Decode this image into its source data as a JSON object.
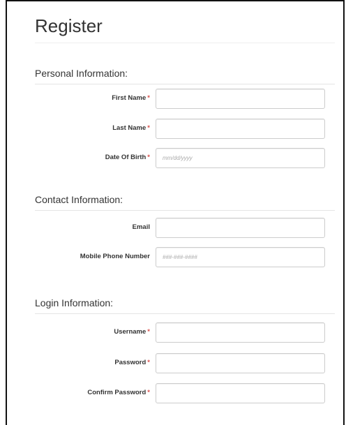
{
  "form": {
    "title": "Register",
    "sections": [
      {
        "heading": "Personal Information:",
        "fields": [
          {
            "label": "First Name",
            "required_mark": "*",
            "value": "",
            "placeholder": ""
          },
          {
            "label": "Last Name",
            "required_mark": "*",
            "value": "",
            "placeholder": ""
          },
          {
            "label": "Date Of Birth",
            "required_mark": "*",
            "value": "",
            "placeholder": "mm/dd/yyyy"
          }
        ]
      },
      {
        "heading": "Contact Information:",
        "fields": [
          {
            "label": "Email",
            "required_mark": "",
            "value": "",
            "placeholder": ""
          },
          {
            "label": "Mobile Phone Number",
            "required_mark": "",
            "value": "",
            "placeholder": "###-###-####"
          }
        ]
      },
      {
        "heading": "Login Information:",
        "fields": [
          {
            "label": "Username",
            "required_mark": "*",
            "value": "",
            "placeholder": ""
          },
          {
            "label": "Password",
            "required_mark": "*",
            "value": "",
            "placeholder": ""
          },
          {
            "label": "Confirm Password",
            "required_mark": "*",
            "value": "",
            "placeholder": ""
          }
        ]
      }
    ]
  },
  "colors": {
    "required": "#d9534f",
    "text": "#333333",
    "input_border": "#cccccc"
  }
}
